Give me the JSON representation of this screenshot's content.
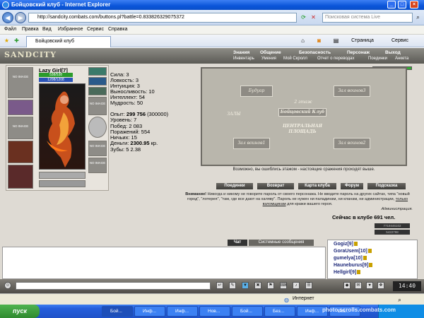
{
  "window": {
    "title": "Бойцовский клуб - Internet Explorer",
    "address": "http://sandcity.combats.com/buttons.pl?battle=0.833826329075372",
    "search_placeholder": "Поисковая система Live"
  },
  "menu": [
    "Файл",
    "Правка",
    "Вид",
    "Избранное",
    "Сервис",
    "Справка"
  ],
  "tab": {
    "label": "Бойцовский клуб"
  },
  "toolbar": {
    "page_label": "Страница",
    "service_label": "Сервис"
  },
  "game": {
    "logo": "SANDCITY",
    "topnav": [
      "Знания",
      "Общение",
      "Безопасность",
      "Персонаж",
      "Выход"
    ],
    "subnav": [
      "Инвентарь",
      "Умения",
      "Мой Скролл",
      "Отчет о переводах",
      "Поединки",
      "Анкета"
    ],
    "character": {
      "nickname": "Lazy Girl",
      "level": "[7]",
      "hp": "538/538",
      "mp": "1208/1208",
      "no_image": "NO IMAGE"
    },
    "stats": [
      {
        "label": "Сила:",
        "value": "3"
      },
      {
        "label": "Ловкость:",
        "value": "3"
      },
      {
        "label": "Интуиция:",
        "value": "3"
      },
      {
        "label": "Выносливость:",
        "value": "10"
      },
      {
        "label": "Интеллект:",
        "value": "54"
      },
      {
        "label": "Мудрость:",
        "value": "50"
      }
    ],
    "stats2": [
      {
        "label": "Опыт:",
        "value": "299 756",
        "extra": "(300000)"
      },
      {
        "label": "Уровень:",
        "value": "7"
      },
      {
        "label": "Побед:",
        "value": "2 083"
      },
      {
        "label": "Поражений:",
        "value": "554"
      },
      {
        "label": "Ничьих:",
        "value": "15"
      },
      {
        "label": "Деньги:",
        "value": "2300.95",
        "extra": "кр."
      },
      {
        "label": "Зубы:",
        "value": "5 2.38"
      }
    ],
    "map": {
      "rooms": {
        "budoir": "Будуар",
        "zal1": "Зал воинов1",
        "zal2": "Зал воинов2",
        "zal3": "Зал воинов3",
        "etazh2": "2 этаж",
        "club": "Бойцовский Клуб",
        "central": "ЦЕНТРАЛЬНАЯ ПЛОЩАДЬ",
        "zaly": "ЗАЛЫ"
      },
      "caption": "Возможно, вы ошиблись этажом - настоящие сражения проходят выше."
    },
    "buttons": [
      "Поединки",
      "Возврат",
      "Карта клуба",
      "Форум",
      "Подсказка"
    ],
    "warning": {
      "bold": "Внимание!",
      "text": "Никогда и никому не говорите пароль от своего персонажа. Не вводите пароль на других сайтах, типа \"новый город\", \"лотерея\", \"там, где все дают на халяву\". Пароль не нужен ни паладинам, ни кланам, ни администрации,",
      "link": "только взломщикам",
      "tail": "для кражи вашего героя.",
      "signature": "Администрация."
    },
    "online": "Сейчас в клубе 691 чел.",
    "counters": [
      "7719446102",
      "5422798"
    ]
  },
  "chat": {
    "tab_chat": "Чат",
    "tab_system": "Системные сообщения",
    "users": [
      {
        "name": "Gogiz",
        "level": "[9]"
      },
      {
        "name": "GoraUsem",
        "level": "[10]"
      },
      {
        "name": "gumelya",
        "level": "[10]"
      },
      {
        "name": "Hauneburus",
        "level": "[9]"
      },
      {
        "name": "Hellgirl",
        "level": "[9]"
      }
    ],
    "clock": "14:40"
  },
  "status": {
    "zone": "Интернет"
  },
  "taskbar": {
    "start": "пуск",
    "tasks": [
      "Бой...",
      "Инф...",
      "Инф...",
      "Нов...",
      "Бой...",
      "Без...",
      "Инф...",
      "Без..."
    ],
    "watermark": "photo.scrolls.combats.com"
  }
}
